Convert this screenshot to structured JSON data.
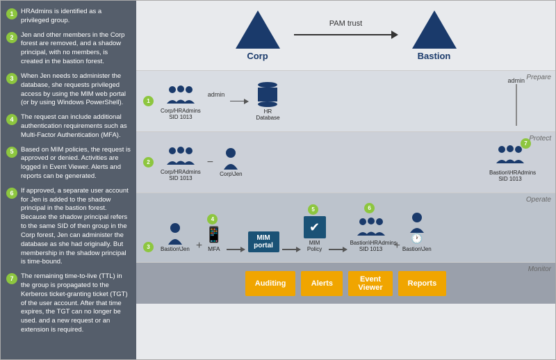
{
  "sidebar": {
    "items": [
      {
        "num": "1",
        "text": "HRAdmins is identified as a privileged group."
      },
      {
        "num": "2",
        "text": "Jen and other members in the Corp forest are removed, and a shadow principal, with no members, is created in the bastion forest."
      },
      {
        "num": "3",
        "text": "When Jen needs to administer the database, she requests privileged access by using the MIM web portal (or by using Windows PowerShell)."
      },
      {
        "num": "4",
        "text": "The request can include additional authentication requirements such as Multi-Factor Authentication (MFA)."
      },
      {
        "num": "5",
        "text": "Based on MIM policies, the request is approved or denied. Activities are logged in Event Viewer. Alerts and reports can be generated."
      },
      {
        "num": "6",
        "text": "If approved, a separate user account for Jen is added to the shadow principal in the bastion forest. Because the shadow principal refers to the same SID of then group in the Corp forest, Jen can administer the database as she had originally. But membership in the shadow principal is time-bound."
      },
      {
        "num": "7",
        "text": "The remaining time-to-live (TTL) in the group is propagated to the Kerberos ticket-granting ticket (TGT) of the user account. After that time expires, the TGT can no longer be used. and a new request or an extension is required."
      }
    ]
  },
  "header": {
    "corp_label": "Corp",
    "bastion_label": "Bastion",
    "pam_trust_label": "PAM trust"
  },
  "sections": {
    "prepare": {
      "label": "Prepare",
      "num": "1",
      "admin1": "admin",
      "admin2": "admin",
      "group1_label": "Corp/HRAdmins\nSID 1013",
      "db_label": "HR\nDatabase"
    },
    "protect": {
      "label": "Protect",
      "num": "2",
      "group1_label": "Corp/HRAdmins\nSID 1013",
      "person_label": "Corp\\Jen",
      "group2_label": "Bastion\\HRAdmins\nSID 1013",
      "badge7": "7"
    },
    "operate": {
      "label": "Operate",
      "num3": "3",
      "num4": "4",
      "num5": "5",
      "num6": "6",
      "person1_label": "Bastion\\Jen",
      "mfa_label": "MFA",
      "mim_label": "MIM\nportal",
      "policy_label": "MIM\nPolicy",
      "group_label": "Bastion\\HRAdmins\nSID 1013",
      "person2_label": "Bastion\\Jen"
    },
    "monitor": {
      "label": "Monitor",
      "buttons": [
        {
          "label": "Auditing"
        },
        {
          "label": "Alerts"
        },
        {
          "label": "Event\nViewer"
        },
        {
          "label": "Reports"
        }
      ]
    }
  }
}
